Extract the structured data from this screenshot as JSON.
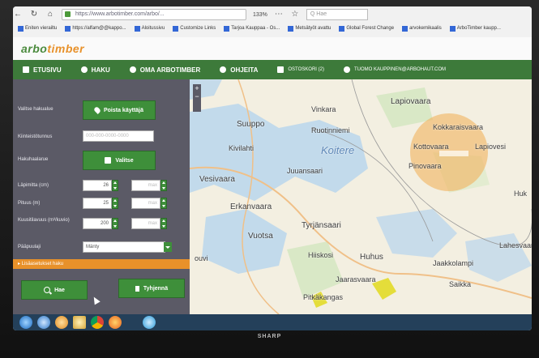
{
  "browser": {
    "back_icon": "back-arrow-icon",
    "reload_icon": "reload-icon",
    "url": "https://www.arbotimber.com/arbo/...",
    "zoom": "133%",
    "search_placeholder": "Q Hae",
    "bookmarks": [
      {
        "label": "Eniten vierailtu",
        "icon": "star-icon"
      },
      {
        "label": "https://alfam@@kappo...",
        "icon": "page-icon"
      },
      {
        "label": "Aloitussivu",
        "icon": "page-icon"
      },
      {
        "label": "Customize Links",
        "icon": "page-icon"
      },
      {
        "label": "Tarjoa Kauppaa - Os...",
        "icon": "page-icon"
      },
      {
        "label": "Metsätyöt avattu",
        "icon": "page-icon"
      },
      {
        "label": "Global Forest Change",
        "icon": "page-icon"
      },
      {
        "label": "arvokemikaalis",
        "icon": "page-icon"
      },
      {
        "label": "ArboTimber kaupp...",
        "icon": "page-icon"
      }
    ]
  },
  "logo": {
    "part1": "arbo",
    "part2": "timber"
  },
  "nav": {
    "items": [
      {
        "label": "ETUSIVU",
        "icon": "home-icon"
      },
      {
        "label": "HAKU",
        "icon": "search-icon"
      },
      {
        "label": "OMA ARBOTIMBER",
        "icon": "user-icon"
      },
      {
        "label": "OHJEITA",
        "icon": "question-icon"
      },
      {
        "label": "OSTOSKORI (2)",
        "icon": "cart-icon"
      },
      {
        "label": "TUOMO KAUPPINEN@ARBOHAUT.COM",
        "icon": "person-icon"
      }
    ]
  },
  "sidebar": {
    "select_label": "Valitse hakualue",
    "select_button": "Poista käyttäjä",
    "property_label": "Kiinteistötunnus",
    "property_placeholder": "000-000-0000-0000",
    "area_label": "Hakuhaalarue",
    "area_button": "Valitse",
    "rows": [
      {
        "label": "Läpimitta (cm)",
        "min": "26",
        "max": "max"
      },
      {
        "label": "Pituus (m)",
        "min": "25",
        "max": "max"
      },
      {
        "label": "Kuusitilavuus (m³/kuvio)",
        "min": "200",
        "max": "max"
      }
    ],
    "species_label": "Pääpuulaji",
    "species_value": "Mänty",
    "more_options": "▸ Lisäasetukset haku",
    "search_button": "Hae",
    "clear_button": "Tyhjennä"
  },
  "map": {
    "zoom_in": "+",
    "zoom_out": "−",
    "labels": [
      "Vinkara",
      "Lapiovaara",
      "Suuppo",
      "Ruotinniemi",
      "Kivilahti",
      "Koitere",
      "Kottovaara",
      "Kokkaraisvaara",
      "Lapiovesi",
      "Vesivaara",
      "Juuansaari",
      "Pinovaara",
      "Erkanvaara",
      "Tyrjänsaari",
      "Vuotsa",
      "Hiiskosi",
      "Huhus",
      "Jaakkolampi",
      "Jaarasvaara",
      "Saikka",
      "Pitkäkangas",
      "Lahesvaara",
      "ouvi",
      "Huk"
    ]
  },
  "taskbar": {
    "icons": [
      "windows-start-icon",
      "browser-icon",
      "media-icon",
      "file-explorer-icon",
      "chrome-icon",
      "firefox-icon",
      "skype-icon"
    ]
  },
  "monitor_brand": "SHARP",
  "colors": {
    "brand_green": "#3d7a3a",
    "accent_orange": "#e8912a",
    "sidebar": "#5b5a66",
    "taskbar": "#24405a",
    "map_lake": "#b9d6ec",
    "search_circle": "#f2b35e"
  }
}
